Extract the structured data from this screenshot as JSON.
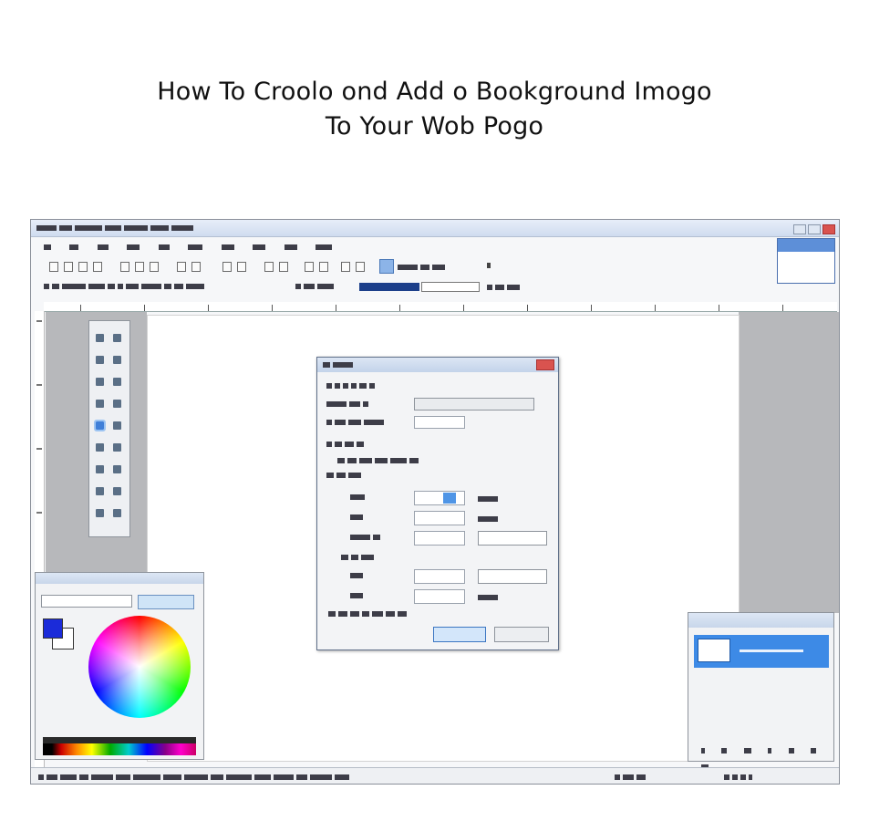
{
  "headline": {
    "line1": "How To Croolo ond Add o Bookground Imogo",
    "line2": "To Your Wob Pogo"
  },
  "colors": {
    "primary_color": "#1b2bd9",
    "secondary_color": "#ffffff",
    "accent": "#3d8ae6",
    "workspace_gray": "#b7b8bb"
  },
  "icons": {
    "tools": [
      "select-icon",
      "lasso-icon",
      "move-icon",
      "zoom-icon",
      "pan-icon",
      "magic-wand-icon",
      "paint-bucket-icon",
      "gradient-icon",
      "brush-icon",
      "eraser-icon",
      "pencil-icon",
      "clone-stamp-icon",
      "recolor-icon",
      "text-icon",
      "line-icon",
      "shapes-icon"
    ]
  }
}
